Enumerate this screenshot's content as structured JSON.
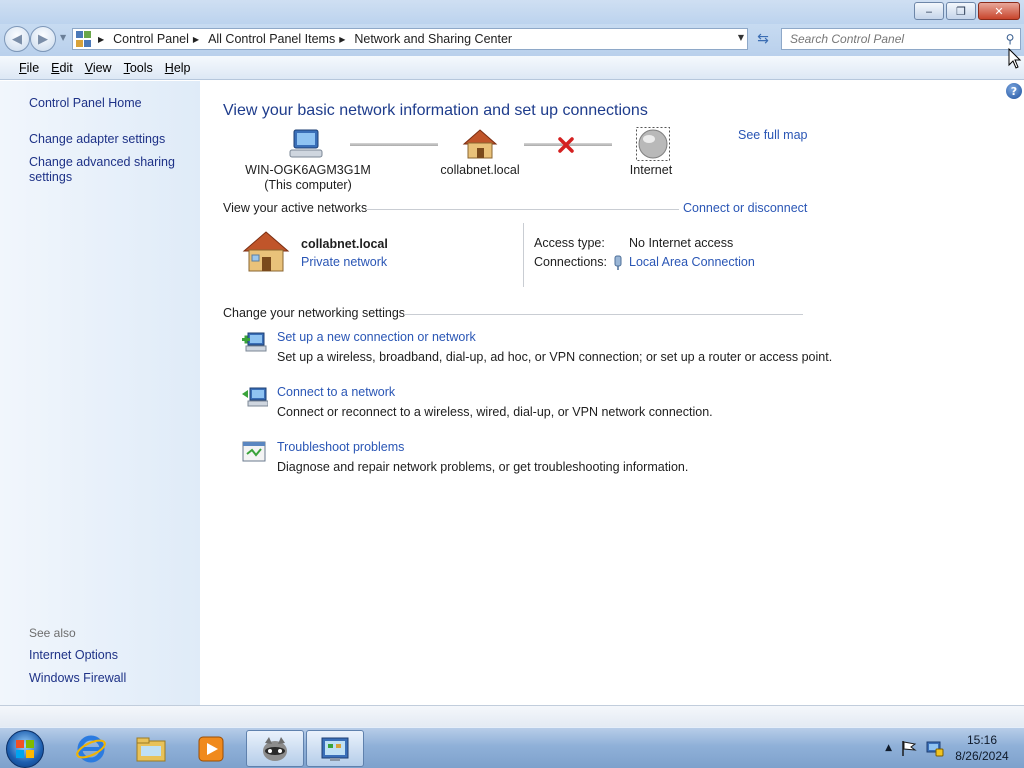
{
  "window": {
    "minimize_label": "‒",
    "maximize_label": "❐",
    "close_label": "✕"
  },
  "address_bar": {
    "breadcrumbs": [
      "Control Panel",
      "All Control Panel Items",
      "Network and Sharing Center"
    ],
    "search_placeholder": "Search Control Panel"
  },
  "menu": [
    "File",
    "Edit",
    "View",
    "Tools",
    "Help"
  ],
  "sidebar": {
    "home": "Control Panel Home",
    "links": [
      "Change adapter settings",
      "Change advanced sharing settings"
    ],
    "see_also_label": "See also",
    "see_also": [
      "Internet Options",
      "Windows Firewall"
    ]
  },
  "main": {
    "title": "View your basic network information and set up connections",
    "see_full_map": "See full map",
    "map": {
      "computer_name": "WIN-OGK6AGM3G1M",
      "computer_sub": "(This computer)",
      "network_name": "collabnet.local",
      "internet_label": "Internet"
    },
    "active_networks": {
      "header": "View your active networks",
      "connect_link": "Connect or disconnect",
      "network_name": "collabnet.local",
      "network_type": "Private network",
      "access_type_label": "Access type:",
      "access_type_value": "No Internet access",
      "connections_label": "Connections:",
      "connections_value": "Local Area Connection"
    },
    "settings": {
      "header": "Change your networking settings",
      "tasks": [
        {
          "title": "Set up a new connection or network",
          "desc": "Set up a wireless, broadband, dial-up, ad hoc, or VPN connection; or set up a router or access point."
        },
        {
          "title": "Connect to a network",
          "desc": "Connect or reconnect to a wireless, wired, dial-up, or VPN network connection."
        },
        {
          "title": "Troubleshoot problems",
          "desc": "Diagnose and repair network problems, or get troubleshooting information."
        }
      ]
    }
  },
  "taskbar": {
    "apps": [
      "ie-icon",
      "explorer-icon",
      "media-player-icon",
      "raccoon-app-icon",
      "control-panel-icon"
    ],
    "time": "15:16",
    "date": "8/26/2024"
  },
  "colors": {
    "link": "#2a56b5",
    "title": "#1e3c8c",
    "sidebar_link": "#1e3287"
  }
}
